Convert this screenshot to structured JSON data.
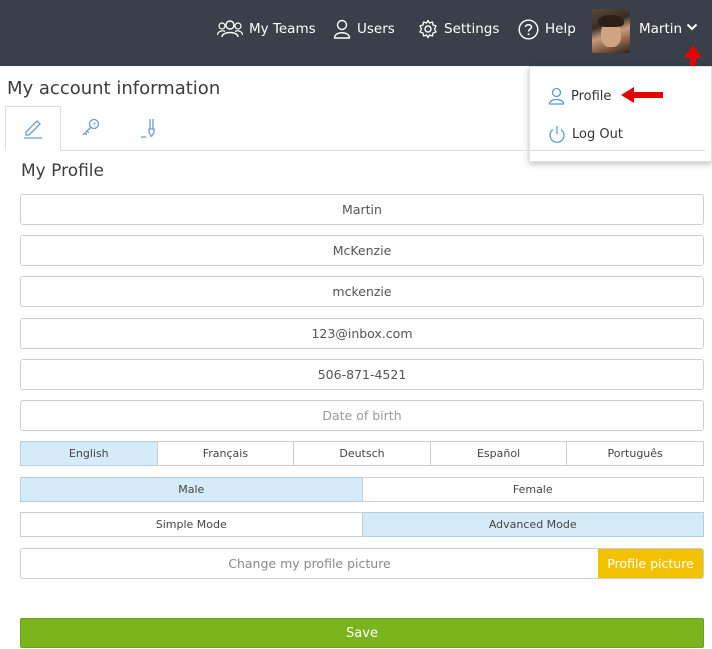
{
  "nav": {
    "my_teams": "My Teams",
    "users": "Users",
    "settings": "Settings",
    "help": "Help",
    "user_name": "Martin"
  },
  "dropdown": {
    "profile": "Profile",
    "logout": "Log Out"
  },
  "page": {
    "title": "My account information",
    "section_title": "My Profile"
  },
  "tabs": [
    {
      "icon": "pencil-icon",
      "active": true
    },
    {
      "icon": "key-icon",
      "active": false
    },
    {
      "icon": "brush-icon",
      "active": false
    }
  ],
  "form": {
    "first_name": "Martin",
    "last_name": "McKenzie",
    "username": "mckenzie",
    "email": "123@inbox.com",
    "phone": "506-871-4521",
    "dob_placeholder": "Date of birth"
  },
  "languages": {
    "options": [
      "English",
      "Français",
      "Deutsch",
      "Español",
      "Português"
    ],
    "selected": "English"
  },
  "gender": {
    "options": [
      "Male",
      "Female"
    ],
    "selected": "Male"
  },
  "mode": {
    "options": [
      "Simple Mode",
      "Advanced Mode"
    ],
    "selected": "Advanced Mode"
  },
  "picture": {
    "label": "Change my profile picture",
    "button": "Profile picture"
  },
  "save_label": "Save",
  "colors": {
    "topbar": "#3a4049",
    "selected": "#d5ebf7",
    "picture_button": "#f2c100",
    "save": "#7ab51d",
    "annotation_arrow": "#e60000"
  }
}
